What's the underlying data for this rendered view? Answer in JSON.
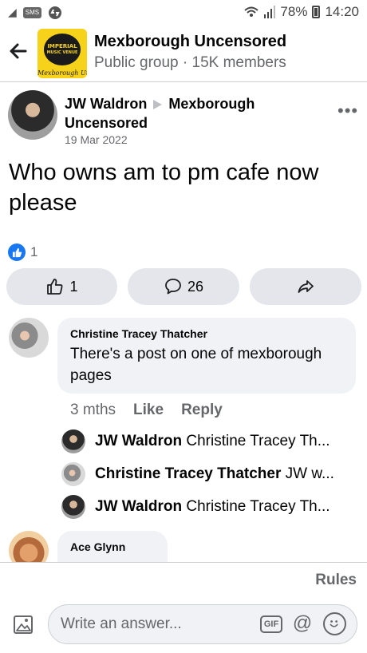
{
  "status_bar": {
    "battery": "78%",
    "time": "14:20",
    "icons": [
      "signal-icon",
      "sms-box-icon",
      "shazam-icon",
      "wifi-icon",
      "cell-signal-icon",
      "battery-icon"
    ]
  },
  "header": {
    "group_name": "Mexborough Uncensored",
    "group_meta": "Public group  ·  15K members",
    "logo": {
      "top_text": "IMPERIAL",
      "sub_text": "MUSIC VENUE",
      "script_text": "Mexborough Uncens"
    }
  },
  "post": {
    "author": "JW Waldron",
    "destination": "Mexborough Uncensored",
    "date": "19 Mar 2022",
    "text": "Who owns am to pm cafe now please",
    "reaction_count": "1",
    "actions": {
      "like_count": "1",
      "comment_count": "26"
    }
  },
  "comments": [
    {
      "author": "Christine Tracey Thatcher",
      "text": "There's a post on  one of mexborough pages",
      "age": "3 mths",
      "like_label": "Like",
      "reply_label": "Reply",
      "replies": [
        {
          "author": "JW Waldron",
          "preview": "Christine Tracey Th..."
        },
        {
          "author": "Christine Tracey Thatcher",
          "preview": "JW w..."
        },
        {
          "author": "JW Waldron",
          "preview": "Christine Tracey Th..."
        }
      ]
    },
    {
      "author": "Ace Glynn"
    }
  ],
  "footer": {
    "rules_label": "Rules",
    "answer_placeholder": "Write an answer...",
    "gif_label": "GIF",
    "at_label": "@"
  },
  "colors": {
    "accent": "#1877f2",
    "secondary_text": "#65676b",
    "bubble": "#f0f2f5",
    "pill": "#e4e6eb"
  }
}
